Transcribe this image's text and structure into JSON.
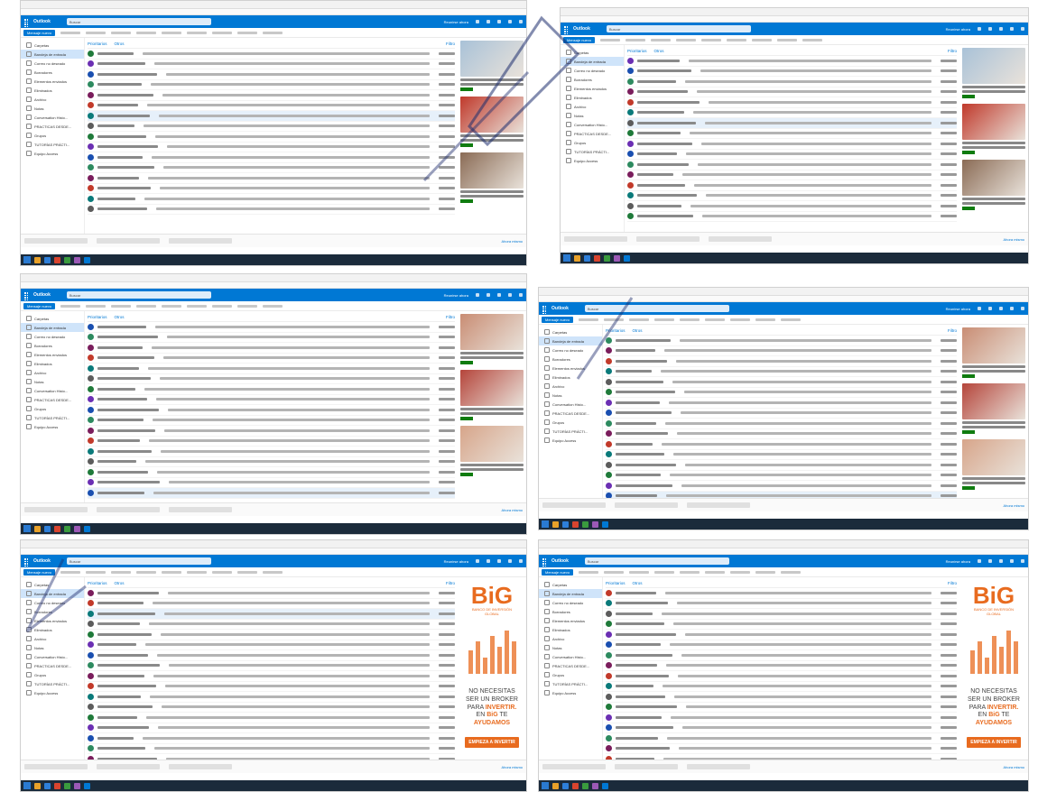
{
  "outlook": {
    "brand": "Outlook",
    "search_placeholder": "Buscar",
    "meet_label": "Reunirse ahora",
    "new_message": "Mensaje nuevo",
    "tab_focused": "Prioritarios",
    "tab_other": "Otros",
    "filter": "Filtro",
    "all_label": "Ahora mismo"
  },
  "nav": [
    "Carpetas",
    "Bandeja de entrada",
    "Correo no deseado",
    "Borradores",
    "Elementos enviados",
    "Eliminados",
    "Archivo",
    "Notas",
    "Conversation Histo...",
    "PRACTICAS DESDE...",
    "Grupos",
    "TUTORÍAS PRÁCTI...",
    "Equipo Access"
  ],
  "panels": [
    {
      "id": "p1",
      "rows": 16,
      "selected": 6,
      "ad": "portraits"
    },
    {
      "id": "p2",
      "rows": 16,
      "selected": 6,
      "ad": "portraits"
    },
    {
      "id": "p3",
      "rows": 17,
      "selected": 16,
      "ad": "faces"
    },
    {
      "id": "p4",
      "rows": 16,
      "selected": 15,
      "ad": "faces"
    },
    {
      "id": "p5",
      "rows": 19,
      "selected": 2,
      "ad": "big"
    },
    {
      "id": "p6",
      "rows": 19,
      "selected": 18,
      "ad": "big"
    }
  ],
  "ads": {
    "big_logo": "BiG",
    "big_logo_sub": "BANCO DE INVERSIÓN GLOBAL",
    "big_line1": "NO NECESITAS",
    "big_line2": "SER UN BROKER",
    "big_line3_a": "PARA ",
    "big_line3_b": "INVERTIR.",
    "big_line4_a": "EN ",
    "big_line4_b": "BiG",
    "big_line4_c": " TE",
    "big_line5": "AYUDAMOS",
    "big_button": "EMPIEZA A INVERTIR"
  },
  "colors": {
    "outlook_blue": "#0078d4",
    "big_orange": "#e86b1f",
    "avatar_palette": [
      "#1f7a3a",
      "#6b2fb3",
      "#1a4fb0",
      "#2d8a5f",
      "#7a1d5c",
      "#c23a2a",
      "#0a7a7a",
      "#5c5c5c"
    ]
  }
}
